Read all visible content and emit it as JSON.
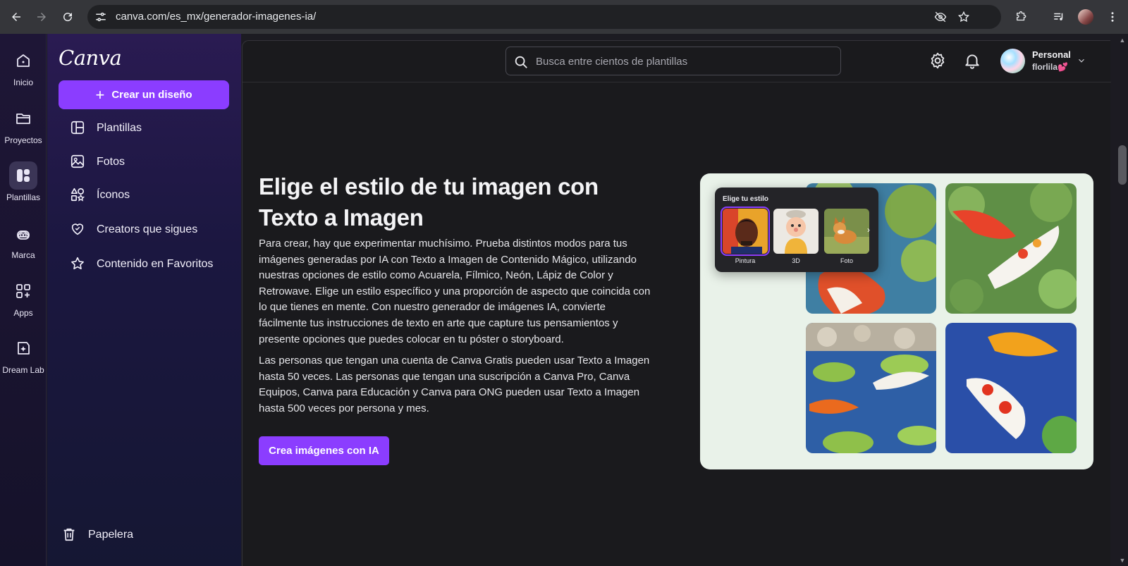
{
  "browser": {
    "url": "canva.com/es_mx/generador-imagenes-ia/"
  },
  "rail": {
    "items": [
      {
        "label": "Inicio",
        "icon": "home-icon"
      },
      {
        "label": "Proyectos",
        "icon": "folder-icon"
      },
      {
        "label": "Plantillas",
        "icon": "templates-icon",
        "active": true
      },
      {
        "label": "Marca",
        "icon": "brand-icon"
      },
      {
        "label": "Apps",
        "icon": "apps-icon"
      },
      {
        "label": "Dream Lab",
        "icon": "dream-lab-icon"
      }
    ]
  },
  "sidebar": {
    "logo": "Canva",
    "create_button": "Crear un diseño",
    "items": [
      {
        "label": "Plantillas",
        "icon": "templates-icon"
      },
      {
        "label": "Fotos",
        "icon": "photo-icon"
      },
      {
        "label": "Íconos",
        "icon": "shapes-icon"
      },
      {
        "label": "Creators que sigues",
        "icon": "heart-icon"
      },
      {
        "label": "Contenido en Favoritos",
        "icon": "star-icon"
      }
    ],
    "trash": "Papelera"
  },
  "topbar": {
    "search_placeholder": "Busca entre cientos de plantillas",
    "account_type": "Personal",
    "account_name": "florlila💕"
  },
  "content": {
    "heading": "Elige el estilo de tu imagen con Texto a Imagen",
    "paragraph1": "Para crear, hay que experimentar muchísimo. Prueba distintos modos para tus imágenes generadas por IA con Texto a Imagen de Contenido Mágico, utilizando nuestras opciones de estilo como Acuarela, Fílmico, Neón, Lápiz de Color y Retrowave. Elige un estilo específico y una proporción de aspecto que coincida con lo que tienes en mente. Con nuestro generador de imágenes IA, convierte fácilmente tus instrucciones de texto en arte que capture tus pensamientos y presente opciones que puedes colocar en tu póster o storyboard.",
    "paragraph2": "Las personas que tengan una cuenta de Canva Gratis pueden usar Texto a Imagen hasta 50 veces. Las personas que tengan una suscripción a Canva Pro, Canva Equipos, Canva para Educación y Canva para ONG pueden usar Texto a Imagen hasta 500 veces por persona y mes.",
    "cta": "Crea imágenes con IA"
  },
  "style_picker": {
    "title": "Elige tu estilo",
    "options": [
      {
        "label": "Pintura",
        "selected": true
      },
      {
        "label": "3D"
      },
      {
        "label": "Foto"
      }
    ]
  },
  "colors": {
    "accent": "#8b3dff",
    "background": "#1a1a1d"
  }
}
